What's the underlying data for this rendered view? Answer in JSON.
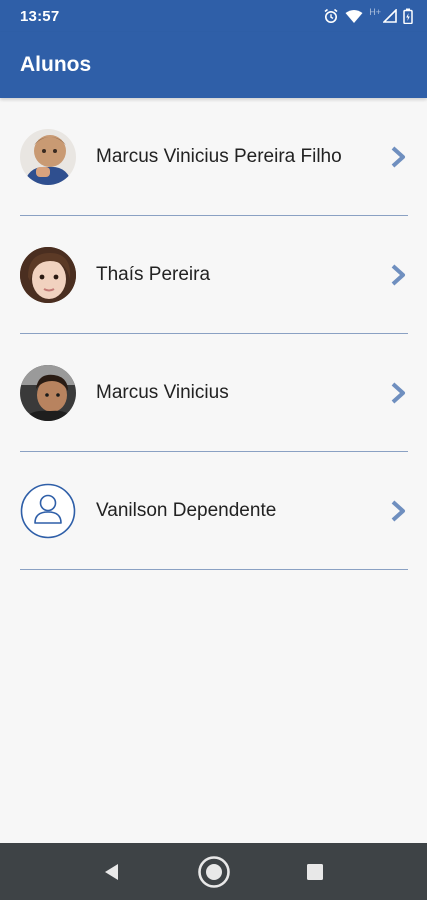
{
  "status": {
    "time": "13:57",
    "network_label": "H+"
  },
  "appbar": {
    "title": "Alunos"
  },
  "students": [
    {
      "name": "Marcus Vinicius Pereira Filho",
      "avatar": "photo-avatar"
    },
    {
      "name": "Thaís Pereira",
      "avatar": "photo-avatar"
    },
    {
      "name": "Marcus Vinicius",
      "avatar": "photo-avatar"
    },
    {
      "name": "Vanilson Dependente",
      "avatar": "user-outline-icon"
    }
  ],
  "colors": {
    "primary": "#2f5fa8",
    "divider": "#8aa1c3",
    "chevron": "#6f8fbf",
    "navbar": "#3e4346"
  },
  "navbar": {
    "icons": [
      "back-icon",
      "home-icon",
      "recents-icon"
    ]
  }
}
